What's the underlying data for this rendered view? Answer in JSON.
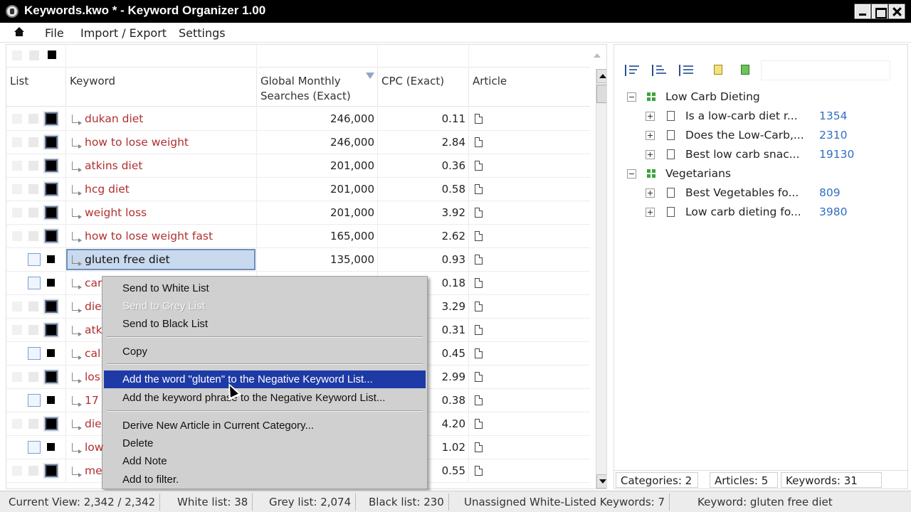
{
  "window": {
    "title": "Keywords.kwo * - Keyword Organizer 1.00"
  },
  "menubar": {
    "items": [
      "File",
      "Import / Export",
      "Settings"
    ]
  },
  "grid": {
    "columns": {
      "list": "List",
      "keyword": "Keyword",
      "searches": "Global Monthly Searches (Exact)",
      "cpc": "CPC (Exact)",
      "article": "Article"
    },
    "rows": [
      {
        "keyword": "dukan diet",
        "searches": "246,000",
        "cpc": "0.11",
        "list": "black"
      },
      {
        "keyword": "how to lose weight",
        "searches": "246,000",
        "cpc": "2.84",
        "list": "black"
      },
      {
        "keyword": "atkins diet",
        "searches": "201,000",
        "cpc": "0.36",
        "list": "black"
      },
      {
        "keyword": "hcg diet",
        "searches": "201,000",
        "cpc": "0.58",
        "list": "black"
      },
      {
        "keyword": "weight loss",
        "searches": "201,000",
        "cpc": "3.92",
        "list": "black"
      },
      {
        "keyword": "how to lose weight fast",
        "searches": "165,000",
        "cpc": "2.62",
        "list": "black"
      },
      {
        "keyword": "gluten free diet",
        "searches": "135,000",
        "cpc": "0.93",
        "list": "white",
        "selected": true
      },
      {
        "keyword": "car",
        "searches": "",
        "cpc": "0.18",
        "list": "white"
      },
      {
        "keyword": "die",
        "searches": "",
        "cpc": "3.29",
        "list": "black"
      },
      {
        "keyword": "atk",
        "searches": "",
        "cpc": "0.31",
        "list": "black"
      },
      {
        "keyword": "cal",
        "searches": "",
        "cpc": "0.45",
        "list": "white"
      },
      {
        "keyword": "los",
        "searches": "",
        "cpc": "2.99",
        "list": "black"
      },
      {
        "keyword": "17",
        "searches": "",
        "cpc": "0.38",
        "list": "white"
      },
      {
        "keyword": "die",
        "searches": "",
        "cpc": "4.20",
        "list": "black"
      },
      {
        "keyword": "low",
        "searches": "",
        "cpc": "1.02",
        "list": "white"
      },
      {
        "keyword": "me",
        "searches": "",
        "cpc": "0.55",
        "list": "black"
      }
    ]
  },
  "context_menu": {
    "items": [
      {
        "label": "Send to White List",
        "state": "normal"
      },
      {
        "label": "Send to Grey List",
        "state": "disabled"
      },
      {
        "label": "Send to Black List",
        "state": "normal"
      },
      {
        "label": "Copy",
        "state": "normal"
      },
      {
        "label": "Add the word \"gluten\" to the Negative Keyword List...",
        "state": "highlighted"
      },
      {
        "label": "Add the keyword phrase to the Negative Keyword List...",
        "state": "normal"
      },
      {
        "label": "Derive New Article in Current Category...",
        "state": "normal"
      },
      {
        "label": "Delete",
        "state": "normal"
      },
      {
        "label": "Add Note",
        "state": "normal"
      },
      {
        "label": "Add to filter.",
        "state": "normal"
      }
    ]
  },
  "tree": {
    "categories": [
      {
        "name": "Low Carb Dieting",
        "articles": [
          {
            "title": "Is a low-carb diet r...",
            "count": "1354"
          },
          {
            "title": "Does the Low-Carb,...",
            "count": "2310"
          },
          {
            "title": "Best low carb snac...",
            "count": "19130"
          }
        ]
      },
      {
        "name": "Vegetarians",
        "articles": [
          {
            "title": "Best Vegetables fo...",
            "count": "809"
          },
          {
            "title": "Low carb dieting fo...",
            "count": "3980"
          }
        ]
      }
    ]
  },
  "right_status": {
    "categories": "Categories: 2",
    "articles": "Articles: 5",
    "keywords": "Keywords: 31"
  },
  "statusbar": {
    "current_view": "Current View: 2,342 / 2,342",
    "white_list": "White list: 38",
    "grey_list": "Grey list: 2,074",
    "black_list": "Black list: 230",
    "unassigned": "Unassigned White-Listed Keywords: 7",
    "keyword": "Keyword: gluten free diet"
  },
  "colors": {
    "keyword_text": "#b03030",
    "menu_highlight": "#1d3aa6",
    "count_link": "#2f6fc4"
  }
}
